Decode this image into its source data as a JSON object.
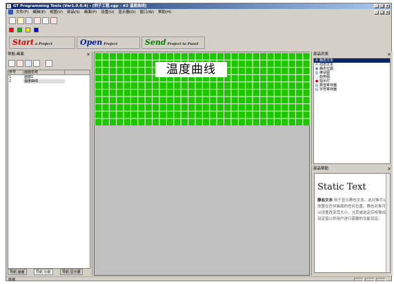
{
  "window": {
    "title": "GT Programming Tools (Ver1.0.0.4) - [例子工程.cgp - #2 温度曲线]"
  },
  "menubar": {
    "items": [
      "文件(F)",
      "编辑(E)",
      "视图(V)",
      "部品(S)",
      "画面(P)",
      "设置(U)",
      "显示器(D)",
      "窗口(W)",
      "帮助(H)"
    ]
  },
  "toolbar": {
    "colors": [
      "#ff0000",
      "#00c000",
      "#ffee00",
      "#0000cc"
    ]
  },
  "actions": {
    "start": {
      "big": "Start",
      "small": "a Project"
    },
    "open": {
      "big": "Open",
      "small": "Project"
    },
    "send": {
      "big": "Send",
      "small": "Project to Panel"
    }
  },
  "left_panel": {
    "title": "导航:画面",
    "close": "×",
    "columns": [
      "序号",
      "画面名称"
    ],
    "rows": [
      {
        "num": "1",
        "name": "画面1"
      },
      {
        "num": "2",
        "name": "温度曲线"
      }
    ],
    "tabs": [
      "导航:画面",
      "导航:功能",
      "导航:显示器"
    ]
  },
  "editor": {
    "screen_title": "温度曲线",
    "grid_color": "#1ec600"
  },
  "parts_panel": {
    "title": "部品列表",
    "close": "×",
    "items": [
      {
        "icon": "A",
        "label": "静态文本"
      },
      {
        "icon": "A",
        "label": "动态文本"
      },
      {
        "icon": "▣",
        "label": "静态位图"
      },
      {
        "icon": "▥",
        "label": "棒状图"
      },
      {
        "icon": "◌",
        "label": "趋势图"
      },
      {
        "icon": "●",
        "label": "指示灯"
      },
      {
        "icon": "▤",
        "label": "数值寄存器"
      },
      {
        "icon": "▤",
        "label": "字符寄存器"
      }
    ]
  },
  "help_panel": {
    "title": "部品帮助",
    "close": "×",
    "heading": "Static Text",
    "term": "静态文本",
    "body": "用于显示静态文本。此对象可以放置在任何画面的任何位置。静态对象可以设置改变其大小。当其被选定后将弹出设定窗以供用户进行需要的功能设定。"
  },
  "status": {
    "text": "就绪"
  }
}
